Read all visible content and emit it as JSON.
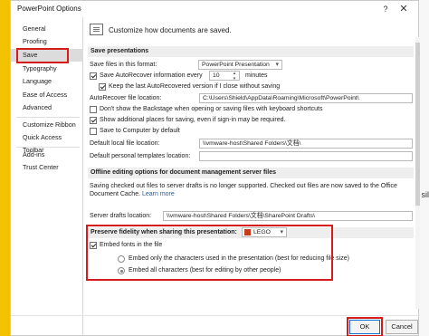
{
  "background": {
    "right_text": "sil"
  },
  "window": {
    "title": "PowerPoint Options",
    "help_glyph": "?",
    "close_glyph": "✕"
  },
  "sidebar": {
    "items": [
      {
        "label": "General"
      },
      {
        "label": "Proofing"
      },
      {
        "label": "Save"
      },
      {
        "label": "Typography"
      },
      {
        "label": "Language"
      },
      {
        "label": "Ease of Access"
      },
      {
        "label": "Advanced"
      },
      {
        "label": "Customize Ribbon"
      },
      {
        "label": "Quick Access Toolbar"
      },
      {
        "label": "Add-ins"
      },
      {
        "label": "Trust Center"
      }
    ],
    "selected": "Save"
  },
  "header": {
    "text": "Customize how documents are saved."
  },
  "save_presentations": {
    "title": "Save presentations",
    "format_label": "Save files in this format:",
    "format_value": "PowerPoint Presentation",
    "autorecover_label": "Save AutoRecover information every",
    "autorecover_value": "10",
    "minutes_label": "minutes",
    "keep_label": "Keep the last AutoRecovered version if I close without saving",
    "autorecover_location_label": "AutoRecover file location:",
    "autorecover_location_value": "C:\\Users\\Shield\\AppData\\Roaming\\Microsoft\\PowerPoint\\",
    "backstage_label": "Don't show the Backstage when opening or saving files with keyboard shortcuts",
    "additional_places_label": "Show additional places for saving, even if sign-in may be required.",
    "save_computer_label": "Save to Computer by default",
    "default_local_label": "Default local file location:",
    "default_local_value": "\\\\vmware-host\\Shared Folders\\文档\\",
    "default_templates_label": "Default personal templates location:",
    "default_templates_value": ""
  },
  "offline_editing": {
    "title": "Offline editing options for document management server files",
    "description": "Saving checked out files to server drafts is no longer supported. Checked out files are now saved to the Office Document Cache.",
    "learn_more": "Learn more",
    "drafts_label": "Server drafts location:",
    "drafts_value": "\\\\vmware-host\\Shared Folders\\文档\\SharePoint Drafts\\"
  },
  "fidelity": {
    "title": "Preserve fidelity when sharing this presentation:",
    "presentation": "LEGO",
    "embed_fonts_label": "Embed fonts in the file",
    "embed_only_label": "Embed only the characters used in the presentation (best for reducing file size)",
    "embed_all_label": "Embed all characters (best for editing by other people)"
  },
  "buttons": {
    "ok": "OK",
    "cancel": "Cancel"
  },
  "colors": {
    "highlight_red": "#d61b1b",
    "powerpoint_orange": "#c43e1c",
    "ok_border": "#0a6ed1"
  }
}
